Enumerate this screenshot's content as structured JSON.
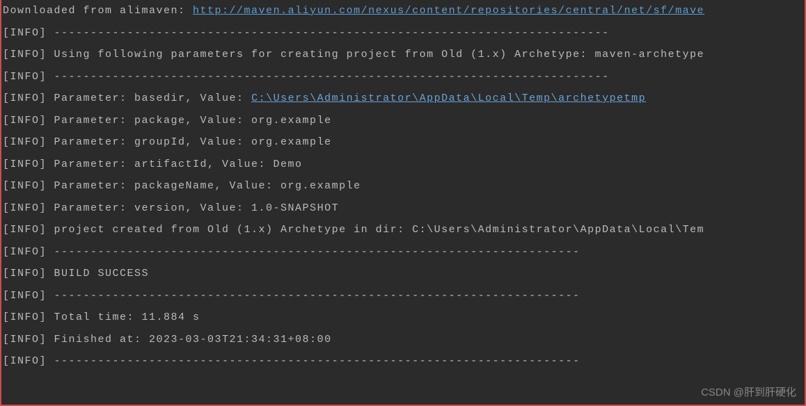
{
  "terminal": {
    "lines": [
      {
        "prefix": "Downloaded from alimaven: ",
        "link": "http://maven.aliyun.com/nexus/content/repositories/central/net/sf/mave",
        "linkClass": "link"
      },
      {
        "text": "[INFO] ----------------------------------------------------------------------------"
      },
      {
        "text": "[INFO] Using following parameters for creating project from Old (1.x) Archetype: maven-archetype"
      },
      {
        "text": "[INFO] ----------------------------------------------------------------------------"
      },
      {
        "prefix": "[INFO] Parameter: basedir, Value: ",
        "link": "C:\\Users\\Administrator\\AppData\\Local\\Temp\\archetypetmp",
        "linkClass": "link2"
      },
      {
        "text": "[INFO] Parameter: package, Value: org.example"
      },
      {
        "text": "[INFO] Parameter: groupId, Value: org.example"
      },
      {
        "text": "[INFO] Parameter: artifactId, Value: Demo"
      },
      {
        "text": "[INFO] Parameter: packageName, Value: org.example"
      },
      {
        "text": "[INFO] Parameter: version, Value: 1.0-SNAPSHOT"
      },
      {
        "text": "[INFO] project created from Old (1.x) Archetype in dir: C:\\Users\\Administrator\\AppData\\Local\\Tem"
      },
      {
        "text": "[INFO] ------------------------------------------------------------------------"
      },
      {
        "text": "[INFO] BUILD SUCCESS"
      },
      {
        "text": "[INFO] ------------------------------------------------------------------------"
      },
      {
        "text": "[INFO] Total time:  11.884 s"
      },
      {
        "text": "[INFO] Finished at: 2023-03-03T21:34:31+08:00"
      },
      {
        "text": "[INFO] ------------------------------------------------------------------------"
      }
    ]
  },
  "watermark": "CSDN @肝到肝硬化"
}
